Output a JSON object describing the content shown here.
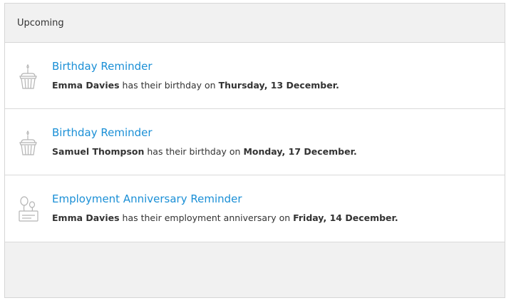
{
  "panel": {
    "title": "Upcoming"
  },
  "reminders": [
    {
      "type": "birthday",
      "icon": "birthday-cake-icon",
      "title": "Birthday Reminder",
      "person": "Emma Davies",
      "middle": "has their birthday on",
      "date": "Thursday, 13 December."
    },
    {
      "type": "birthday",
      "icon": "birthday-cake-icon",
      "title": "Birthday Reminder",
      "person": "Samuel Thompson",
      "middle": "has their birthday on",
      "date": "Monday, 17 December."
    },
    {
      "type": "anniversary",
      "icon": "anniversary-balloons-icon",
      "title": "Employment Anniversary Reminder",
      "person": "Emma Davies",
      "middle": "has their employment anniversary on",
      "date": "Friday, 14 December."
    }
  ],
  "colors": {
    "link": "#1a8fd6",
    "text": "#333333",
    "header_bg": "#f1f1f1",
    "border": "#d6d6d6"
  }
}
